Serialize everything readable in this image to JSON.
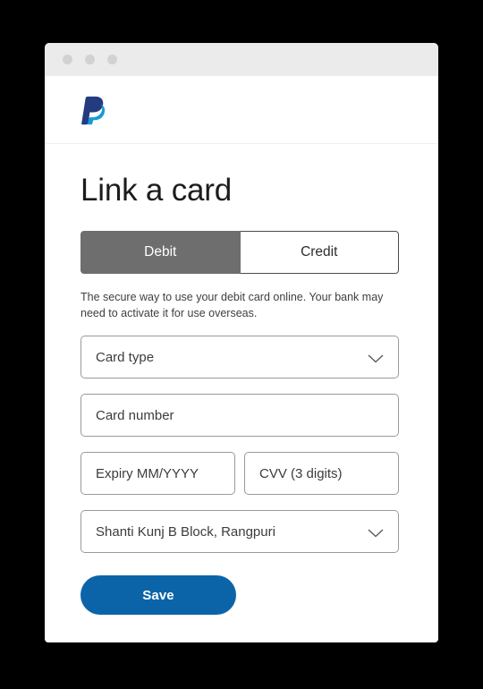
{
  "window": {
    "titlebar": {
      "dots": [
        "window-dot-close",
        "window-dot-minimize",
        "window-dot-maximize"
      ]
    },
    "brand": {
      "logo_icon": "paypal-logo-icon",
      "colors": {
        "dark_blue": "#253b80",
        "light_blue": "#179bd7"
      }
    }
  },
  "page": {
    "title": "Link a card"
  },
  "tabs": [
    {
      "label": "Debit",
      "active": true
    },
    {
      "label": "Credit",
      "active": false
    }
  ],
  "helper_text": "The secure way to use your debit card online. Your bank may need to activate it for use overseas.",
  "fields": {
    "card_type": {
      "placeholder": "Card type",
      "value": "",
      "icon": "chevron-down-icon"
    },
    "card_number": {
      "placeholder": "Card number",
      "value": ""
    },
    "expiry": {
      "placeholder": "Expiry MM/YYYY",
      "value": ""
    },
    "cvv": {
      "placeholder": "CVV (3 digits)",
      "value": ""
    },
    "billing_address": {
      "value": "Shanti Kunj B Block, Rangpuri",
      "icon": "chevron-down-icon"
    }
  },
  "actions": {
    "save_label": "Save",
    "save_color": "#0c64a8"
  }
}
